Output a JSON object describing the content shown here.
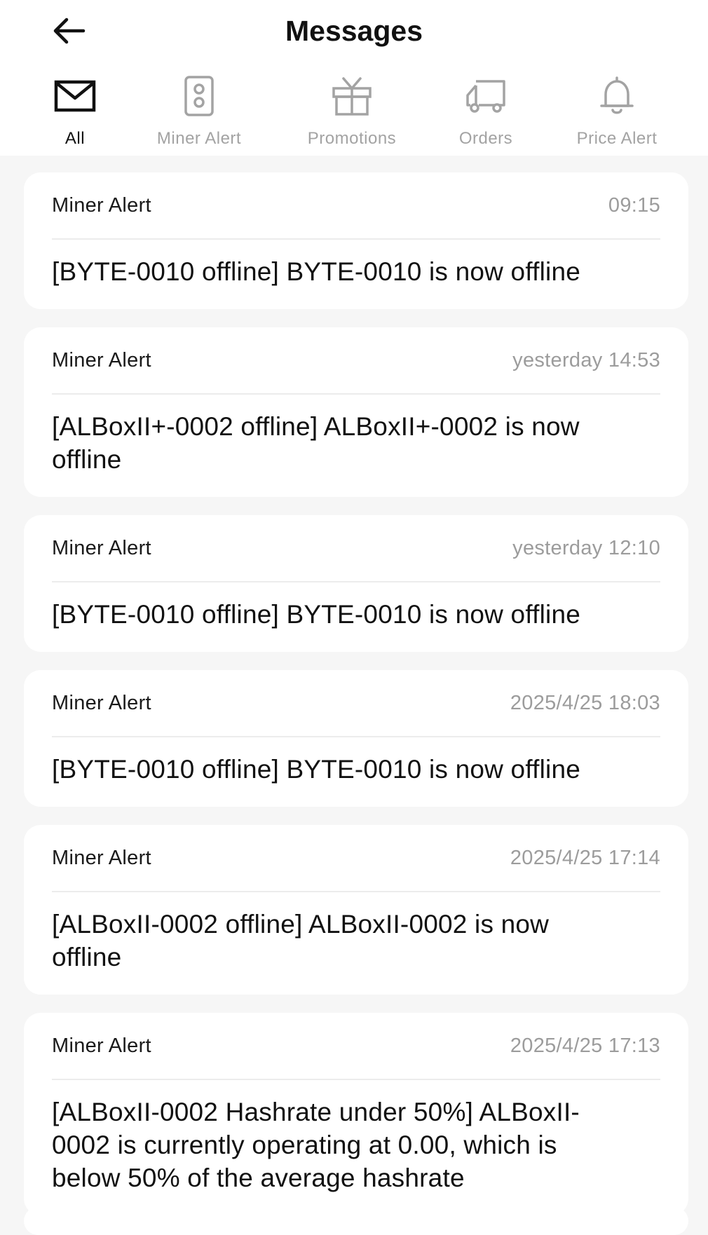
{
  "header": {
    "title": "Messages",
    "back_icon": "arrow-left-icon"
  },
  "tabs": [
    {
      "label": "All",
      "icon": "envelope-icon",
      "active": true
    },
    {
      "label": "Miner Alert",
      "icon": "miner-device-icon",
      "active": false
    },
    {
      "label": "Promotions",
      "icon": "gift-icon",
      "active": false
    },
    {
      "label": "Orders",
      "icon": "truck-icon",
      "active": false
    },
    {
      "label": "Price Alert",
      "icon": "bell-icon",
      "active": false
    }
  ],
  "messages": [
    {
      "type": "Miner Alert",
      "time": "09:15",
      "text": "[BYTE-0010 offline] BYTE-0010 is now offline"
    },
    {
      "type": "Miner Alert",
      "time": "yesterday 14:53",
      "text": "[ALBoxII+-0002 offline] ALBoxII+-0002 is now offline"
    },
    {
      "type": "Miner Alert",
      "time": "yesterday 12:10",
      "text": "[BYTE-0010 offline] BYTE-0010 is now offline"
    },
    {
      "type": "Miner Alert",
      "time": "2025/4/25 18:03",
      "text": "[BYTE-0010 offline] BYTE-0010 is now offline"
    },
    {
      "type": "Miner Alert",
      "time": "2025/4/25 17:14",
      "text": "[ALBoxII-0002 offline] ALBoxII-0002 is now offline"
    },
    {
      "type": "Miner Alert",
      "time": "2025/4/25 17:13",
      "text": "[ALBoxII-0002 Hashrate under 50%] ALBoxII-0002 is currently operating at 0.00, which is below 50% of the average hashrate"
    }
  ],
  "colors": {
    "background": "#f6f6f6",
    "card": "#ffffff",
    "text_primary": "#111111",
    "text_secondary": "#9c9c9c",
    "tab_inactive": "#a3a3a3"
  }
}
